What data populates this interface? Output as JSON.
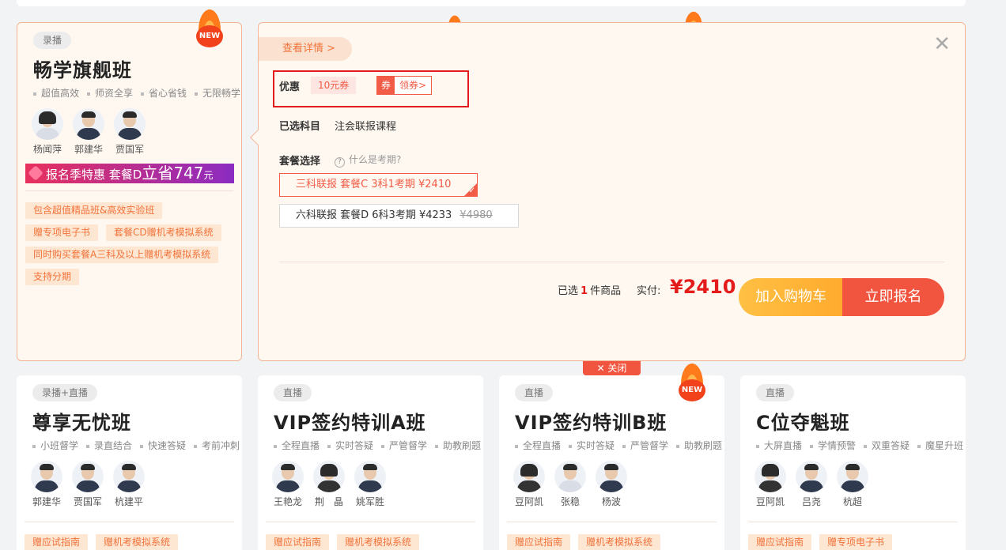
{
  "cards": [
    {
      "tag": "录播",
      "title": "畅学旗舰班",
      "features": [
        "超值高效",
        "师资全享",
        "省心省钱",
        "无限畅学"
      ],
      "teachers": [
        "杨闻萍",
        "郭建华",
        "贾国军"
      ],
      "promo": {
        "text": "报名季特惠 套餐D",
        "big": "立省747",
        "unit": "元"
      },
      "chips": [
        "包含超值精品班&高效实验班",
        "赠专项电子书",
        "套餐CD赠机考模拟系统",
        "同时购买套餐A三科及以上赠机考模拟系统",
        "支持分期"
      ],
      "badge": "NEW"
    },
    {
      "tag": "录播+直播",
      "title": "尊享无忧班",
      "features": [
        "小班督学",
        "录直结合",
        "快速答疑",
        "考前冲刺"
      ],
      "teachers": [
        "郭建华",
        "贾国军",
        "杭建平"
      ],
      "chips": [
        "赠应试指南",
        "赠机考模拟系统"
      ]
    },
    {
      "tag": "直播",
      "title": "VIP签约特训A班",
      "features": [
        "全程直播",
        "实时答疑",
        "严管督学",
        "助教刷题"
      ],
      "teachers": [
        "王艳龙",
        "荆　晶",
        "姚军胜"
      ],
      "chips": [
        "赠应试指南",
        "赠机考模拟系统"
      ]
    },
    {
      "tag": "直播",
      "title": "VIP签约特训B班",
      "features": [
        "全程直播",
        "实时答疑",
        "严管督学",
        "助教刷题"
      ],
      "teachers": [
        "豆阿凯",
        "张稳",
        "杨波"
      ],
      "chips": [
        "赠应试指南",
        "赠机考模拟系统"
      ],
      "badge": "NEW"
    },
    {
      "tag": "直播",
      "title": "C位夺魁班",
      "features": [
        "大屏直播",
        "学情预警",
        "双重答疑",
        "魔星升班"
      ],
      "teachers": [
        "豆阿凯",
        "吕尧",
        "杭超"
      ],
      "chips": [
        "赠应试指南",
        "赠专项电子书"
      ]
    }
  ],
  "panel": {
    "detail_link": "查看详情 >",
    "close": "✕",
    "discount_label": "优惠",
    "coupon": "10元券",
    "coupon_icon": "券",
    "get_coupon": "领券>",
    "subject_label": "已选科目",
    "subject": "注会联报课程",
    "package_label": "套餐选择",
    "help": "什么是考期?",
    "packages": [
      {
        "label": "三科联报 套餐C 3科1考期 ¥2410",
        "selected": true
      },
      {
        "label": "六科联报 套餐D 6科3考期 ¥4233",
        "original": "¥4980",
        "selected": false
      }
    ],
    "summary_pre": "已选",
    "summary_count": "1",
    "summary_post": "件商品",
    "pay_label": "实付:",
    "price": "¥2410",
    "add_cart": "加入购物车",
    "buy_now": "立即报名",
    "collapse": "✕ 关闭"
  },
  "colors": {
    "accent": "#f2553f",
    "panel_bg": "#fff8f1",
    "chip_bg": "#fde6d2"
  }
}
